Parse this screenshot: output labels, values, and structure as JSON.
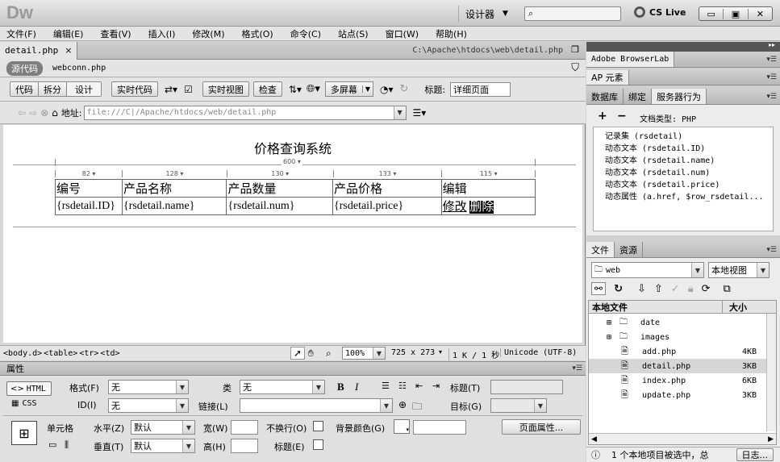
{
  "app": {
    "logo": "Dw",
    "workspace": "设计器",
    "search_placeholder": "",
    "cslive": "CS Live"
  },
  "menu": [
    "文件(F)",
    "编辑(E)",
    "查看(V)",
    "插入(I)",
    "修改(M)",
    "格式(O)",
    "命令(C)",
    "站点(S)",
    "窗口(W)",
    "帮助(H)"
  ],
  "doc": {
    "tab": "detail.php",
    "path": "C:\\Apache\\htdocs\\web\\detail.php",
    "source_code": "源代码",
    "related_file": "webconn.php"
  },
  "toolbar": {
    "code": "代码",
    "split": "拆分",
    "design": "设计",
    "live_code": "实时代码",
    "live_view": "实时视图",
    "inspect": "检查",
    "multiscreen": "多屏幕",
    "title_label": "标题:",
    "title_value": "详细页面"
  },
  "address": {
    "label": "地址:",
    "value": "file:///C|/Apache/htdocs/web/detail.php"
  },
  "design": {
    "heading": "价格查询系统",
    "table_width": "600",
    "col_widths": [
      "82",
      "128",
      "130",
      "133",
      "115"
    ],
    "headers": [
      "编号",
      "产品名称",
      "产品数量",
      "产品价格",
      "编辑"
    ],
    "row": [
      "{rsdetail.ID}",
      "{rsdetail.name}",
      "{rsdetail.num}",
      "{rsdetail.price}"
    ],
    "edit_link": "修改",
    "delete_link": "删除"
  },
  "status": {
    "tags": [
      "<body.d>",
      "<table>",
      "<tr>",
      "<td>"
    ],
    "zoom": "100%",
    "size": "725 x 273",
    "weight": "1 K / 1 秒",
    "encoding": "Unicode (UTF-8)"
  },
  "props": {
    "title": "属性",
    "html": "HTML",
    "css": "CSS",
    "format_label": "格式(F)",
    "format_value": "无",
    "class_label": "类",
    "class_value": "无",
    "id_label": "ID(I)",
    "id_value": "无",
    "link_label": "链接(L)",
    "title_label": "标题(T)",
    "target_label": "目标(G)",
    "cell_label": "单元格",
    "horiz_label": "水平(Z)",
    "horiz_value": "默认",
    "vert_label": "垂直(T)",
    "vert_value": "默认",
    "width_label": "宽(W)",
    "height_label": "高(H)",
    "nowrap_label": "不换行(O)",
    "header_label": "标题(E)",
    "bg_label": "背景颜色(G)",
    "page_props": "页面属性..."
  },
  "panels": {
    "browserlab": "Adobe BrowserLab",
    "ap": "AP 元素",
    "tabs": [
      "数据库",
      "绑定",
      "服务器行为"
    ],
    "doc_type": "文档类型: PHP",
    "behaviors": [
      "记录集 (rsdetail)",
      "动态文本 (rsdetail.ID)",
      "动态文本 (rsdetail.name)",
      "动态文本 (rsdetail.num)",
      "动态文本 (rsdetail.price)",
      "动态属性 (a.href, $row_rsdetail..."
    ],
    "files_tabs": [
      "文件",
      "资源"
    ],
    "site": "web",
    "view": "本地视图",
    "col_local": "本地文件",
    "col_size": "大小",
    "files": [
      {
        "name": "date",
        "size": "",
        "folder": true
      },
      {
        "name": "images",
        "size": "",
        "folder": true
      },
      {
        "name": "add.php",
        "size": "4KB",
        "folder": false
      },
      {
        "name": "detail.php",
        "size": "3KB",
        "folder": false
      },
      {
        "name": "index.php",
        "size": "6KB",
        "folder": false
      },
      {
        "name": "update.php",
        "size": "3KB",
        "folder": false
      }
    ],
    "footer": "1 个本地项目被选中，总",
    "log": "日志..."
  }
}
